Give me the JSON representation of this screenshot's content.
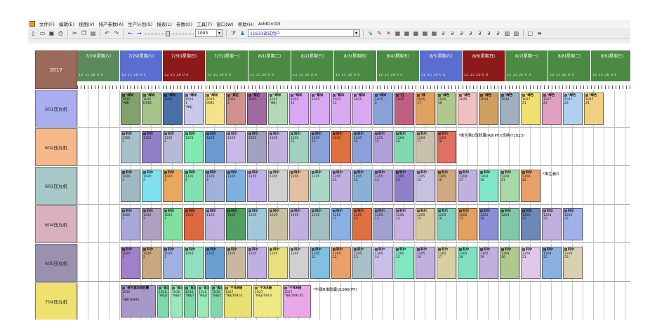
{
  "menu": [
    "文件(F)",
    "编辑(E)",
    "视图(V)",
    "排产参数(A)",
    "生产计划(S)",
    "报表(L)",
    "参数(O)",
    "工具(T)",
    "窗口(W)",
    "帮助(H)",
    "AddOn(D)"
  ],
  "toolbar": {
    "zoom_value": "1005",
    "line_combo_value": "11633调试用户"
  },
  "year_label": "2017",
  "hours_label": "12 15 20 0 4",
  "dates": [
    {
      "label": "7/29(星期六)",
      "color": "#5a8a5a"
    },
    {
      "label": "7/29(星期六)",
      "color": "#5a6ed0"
    },
    {
      "label": "7/30(星期日)",
      "color": "#8c1a1a"
    },
    {
      "label": "7/31(星期一)",
      "color": "#4a8a42"
    },
    {
      "label": "8/1(星期二)",
      "color": "#4a8a42"
    },
    {
      "label": "8/2(星期三)",
      "color": "#4a8a42"
    },
    {
      "label": "8/3(星期四)",
      "color": "#4a8a42"
    },
    {
      "label": "8/4(星期五)",
      "color": "#4a8a42"
    },
    {
      "label": "8/5(星期六)",
      "color": "#5a6ed0"
    },
    {
      "label": "8/6(星期日)",
      "color": "#8c1a1a"
    },
    {
      "label": "8/7(星期一)",
      "color": "#4a8a42"
    },
    {
      "label": "8/8(星期二)",
      "color": "#4a8a42"
    },
    {
      "label": "8/9(星期三)",
      "color": "#4a8a42"
    }
  ],
  "rows": [
    {
      "name": "601压丸机",
      "color": "#a8aef0",
      "tasks": [
        {
          "l1": "\"绿米",
          "l2": "1015",
          "l3": "",
          "l4": "\"NBJ",
          "color": "#7fa36a"
        },
        {
          "l1": "\"绿米",
          "l2": "1015",
          "l3": "",
          "l4": "D082",
          "color": "#a7c48a"
        },
        {
          "l1": "\"绿米",
          "l2": "1015",
          "l3": "",
          "l4": "",
          "color": "#4a6ea8"
        },
        {
          "l1": "\"绿米",
          "l2": "1015",
          "l3": "1",
          "l4": "\"NBJ",
          "color": "#c9c7ea"
        },
        {
          "l1": "\"绿米",
          "l2": "1020",
          "l3": "",
          "l4": "0081",
          "color": "#f3e28a"
        },
        {
          "l1": "\"紫红",
          "l2": "1023",
          "l3": "2",
          "l4": "",
          "color": "#d09090"
        },
        {
          "l1": "\"紫红",
          "l2": "1023",
          "l3": "",
          "l4": "",
          "color": "#a06aa0"
        },
        {
          "l1": "\"绿米",
          "l2": "1015",
          "l3": "",
          "l4": "\"NBJ",
          "color": "#b4d8b4"
        },
        {
          "l1": "\"绿米",
          "l2": "1015",
          "l3": "11",
          "l4": "",
          "color": "#d8a8f0"
        },
        {
          "l1": "\"紫米",
          "l2": "1015",
          "l3": "",
          "l4": "",
          "color": "#d8a8f0"
        },
        {
          "l1": "\"紫米",
          "l2": "1015",
          "l3": "12",
          "l4": "",
          "color": "#d8a8f0"
        },
        {
          "l1": "\"紫米",
          "l2": "1015",
          "l3": "",
          "l4": "",
          "color": "#d8a8f0"
        },
        {
          "l1": "\"绿米",
          "l2": "1015",
          "l3": "2",
          "l4": "",
          "color": "#8aa0d8"
        },
        {
          "l1": "\"红",
          "l2": "1025",
          "l3": "",
          "l4": "",
          "color": "#c06080"
        },
        {
          "l1": "\"绿",
          "l2": "1025",
          "l3": "17",
          "l4": "",
          "color": "#e0a060"
        },
        {
          "l1": "\"绿色",
          "l2": "1025",
          "l3": "18",
          "l4": "",
          "color": "#b0c890"
        },
        {
          "l1": "\"绿色",
          "l2": "1025",
          "l3": "",
          "l4": "",
          "color": "#f0c0c0"
        },
        {
          "l1": "\"绿色",
          "l2": "1014",
          "l3": "",
          "l4": "",
          "color": "#d0a060"
        },
        {
          "l1": "\"绿色",
          "l2": "1014",
          "l3": "",
          "l4": "",
          "color": "#a0b0c0"
        },
        {
          "l1": "\"绿色",
          "l2": "1027",
          "l3": "21",
          "l4": "",
          "color": "#f0e070"
        },
        {
          "l1": "\"绿色",
          "l2": "1027",
          "l3": "22",
          "l4": "",
          "color": "#e0a0c0"
        },
        {
          "l1": "\"绿色",
          "l2": "1027",
          "l3": "23",
          "l4": "",
          "color": "#b0d0f0"
        },
        {
          "l1": "\"绿色",
          "l2": "1027",
          "l3": "24",
          "l4": "",
          "color": "#f0d080"
        }
      ]
    },
    {
      "name": "602压丸机",
      "color": "#f5b888",
      "note": "*维生素D软胶囊(A8(PF)(规格IT1823)",
      "tasks": [
        {
          "l1": "科尔",
          "l2": "1105",
          "l3": "1",
          "l4": "",
          "color": "#a8c0c8"
        },
        {
          "l1": "科尔",
          "l2": "1105",
          "l3": "",
          "l4": "",
          "color": "#9080c8"
        },
        {
          "l1": "科尔",
          "l2": "1105",
          "l3": "3",
          "l4": "",
          "color": "#b8b8d8"
        },
        {
          "l1": "科尔",
          "l2": "1205",
          "l3": "",
          "l4": "",
          "color": "#80e8b0"
        },
        {
          "l1": "科尔",
          "l2": "1205",
          "l3": "",
          "l4": "",
          "color": "#6a9ad0"
        },
        {
          "l1": "科尔",
          "l2": "1205",
          "l3": "",
          "l4": "",
          "color": "#c8b8e8"
        },
        {
          "l1": "科尔",
          "l2": "1205",
          "l3": "",
          "l4": "",
          "color": "#a0a0c0"
        },
        {
          "l1": "科尔",
          "l2": "1205",
          "l3": "",
          "l4": "",
          "color": "#c0b0e0"
        },
        {
          "l1": "科尔",
          "l2": "1205",
          "l3": "11",
          "l4": "",
          "color": "#a0d0c0"
        },
        {
          "l1": "科尔",
          "l2": "1205",
          "l3": "12",
          "l4": "",
          "color": "#8aa0d8"
        },
        {
          "l1": "科尔",
          "l2": "1205",
          "l3": "",
          "l4": "",
          "color": "#e07040"
        },
        {
          "l1": "科尔",
          "l2": "1205",
          "l3": "14",
          "l4": "",
          "color": "#8aa0d8"
        },
        {
          "l1": "科尔",
          "l2": "1205",
          "l3": "15",
          "l4": "",
          "color": "#b0a0d8"
        },
        {
          "l1": "科尔",
          "l2": "1204",
          "l3": "16",
          "l4": "",
          "color": "#80d8b0"
        },
        {
          "l1": "科尔",
          "l2": "1204",
          "l3": "17",
          "l4": "",
          "color": "#c8c0a8"
        },
        {
          "l1": "科尔",
          "l2": "1204",
          "l3": "18",
          "l4": "",
          "color": "#e07060"
        }
      ]
    },
    {
      "name": "603压丸机",
      "color": "#a8c8c8",
      "note": "*维生素D",
      "tasks": [
        {
          "l1": "科尔",
          "l2": "1020",
          "l3": "1",
          "l4": "",
          "color": "#a0b8c0"
        },
        {
          "l1": "科尔",
          "l2": "1020",
          "l3": "2",
          "l4": "",
          "color": "#80e0f0"
        },
        {
          "l1": "科尔",
          "l2": "1020",
          "l3": "3",
          "l4": "",
          "color": "#e8a860"
        },
        {
          "l1": "科尔",
          "l2": "1105",
          "l3": "4",
          "l4": "",
          "color": "#80e0b0"
        },
        {
          "l1": "科尔",
          "l2": "1105",
          "l3": "5",
          "l4": "",
          "color": "#a0b0d8"
        },
        {
          "l1": "科尔",
          "l2": "1105",
          "l3": "",
          "l4": "",
          "color": "#80b0e0"
        },
        {
          "l1": "科尔",
          "l2": "1205",
          "l3": "",
          "l4": "",
          "color": "#c0b0e8"
        },
        {
          "l1": "科尔",
          "l2": "1205",
          "l3": "",
          "l4": "",
          "color": "#d0d0d0"
        },
        {
          "l1": "科尔",
          "l2": "1205",
          "l3": "",
          "l4": "",
          "color": "#e0c0a0"
        },
        {
          "l1": "科尔",
          "l2": "1205",
          "l3": "",
          "l4": "",
          "color": "#a8d8c8"
        },
        {
          "l1": "科尔",
          "l2": "1205",
          "l3": "11",
          "l4": "",
          "color": "#c0b0e0"
        },
        {
          "l1": "科尔",
          "l2": "1205",
          "l3": "12",
          "l4": "",
          "color": "#8ab0d8"
        },
        {
          "l1": "科尔",
          "l2": "1205",
          "l3": "13",
          "l4": "",
          "color": "#b0a0d8"
        },
        {
          "l1": "科尔",
          "l2": "1205",
          "l3": "14",
          "l4": "",
          "color": "#9080c8"
        },
        {
          "l1": "科尔",
          "l2": "1205",
          "l3": "15",
          "l4": "",
          "color": "#c8c0e0"
        },
        {
          "l1": "科尔",
          "l2": "1205",
          "l3": "16",
          "l4": "",
          "color": "#d0a880"
        },
        {
          "l1": "科尔",
          "l2": "1204",
          "l3": "17",
          "l4": "",
          "color": "#c0b0e0"
        },
        {
          "l1": "科尔",
          "l2": "1204",
          "l3": "18",
          "l4": "",
          "color": "#80e8c8"
        },
        {
          "l1": "科尔",
          "l2": "1204",
          "l3": "21",
          "l4": "",
          "color": "#a8d8a8"
        },
        {
          "l1": "科尔",
          "l2": "1204",
          "l3": "22",
          "l4": "",
          "color": "#e8a068"
        }
      ]
    },
    {
      "name": "604压丸机",
      "color": "#d8b0c0",
      "tasks": [
        {
          "l1": "科尔",
          "l2": "1020",
          "l3": "1",
          "l4": "",
          "color": "#a8a8d8"
        },
        {
          "l1": "科尔",
          "l2": "1020",
          "l3": "2",
          "l4": "",
          "color": "#b0a0c0"
        },
        {
          "l1": "科尔",
          "l2": "1020",
          "l3": "3",
          "l4": "",
          "color": "#80e0a0"
        },
        {
          "l1": "科尔",
          "l2": "1105",
          "l3": "",
          "l4": "",
          "color": "#e06840"
        },
        {
          "l1": "科尔",
          "l2": "1105",
          "l3": "",
          "l4": "",
          "color": "#c0b0e0"
        },
        {
          "l1": "科尔",
          "l2": "1105",
          "l3": "",
          "l4": "",
          "color": "#50a060"
        },
        {
          "l1": "科尔",
          "l2": "1105",
          "l3": "",
          "l4": "",
          "color": "#a0c8d8"
        },
        {
          "l1": "科尔",
          "l2": "1205",
          "l3": "",
          "l4": "",
          "color": "#c8c0a0"
        },
        {
          "l1": "科尔",
          "l2": "1205",
          "l3": "",
          "l4": "",
          "color": "#c0b0e0"
        },
        {
          "l1": "科尔",
          "l2": "1205",
          "l3": "",
          "l4": "",
          "color": "#a0c0c0"
        },
        {
          "l1": "科尔",
          "l2": "1205",
          "l3": "11",
          "l4": "",
          "color": "#8ab0e8"
        },
        {
          "l1": "科尔",
          "l2": "1205",
          "l3": "12",
          "l4": "",
          "color": "#e07040"
        },
        {
          "l1": "科尔",
          "l2": "1205",
          "l3": "13",
          "l4": "",
          "color": "#a0a0d0"
        },
        {
          "l1": "科尔",
          "l2": "1205",
          "l3": "14",
          "l4": "",
          "color": "#c8b0e0"
        },
        {
          "l1": "科尔",
          "l2": "1205",
          "l3": "15",
          "l4": "",
          "color": "#d8c8a0"
        },
        {
          "l1": "科尔",
          "l2": "1205",
          "l3": "16",
          "l4": "",
          "color": "#80d0c0"
        },
        {
          "l1": "科尔",
          "l2": "1205",
          "l3": "17",
          "l4": "",
          "color": "#e0a060"
        },
        {
          "l1": "科尔",
          "l2": "1205",
          "l3": "18",
          "l4": "",
          "color": "#8a90d8"
        },
        {
          "l1": "科尔",
          "l2": "1204",
          "l3": "",
          "l4": "",
          "color": "#80c8a8"
        },
        {
          "l1": "科尔",
          "l2": "1204",
          "l3": "21",
          "l4": "",
          "color": "#6a88b8"
        },
        {
          "l1": "科尔",
          "l2": "1204",
          "l3": "22",
          "l4": "",
          "color": "#c0b0e0"
        },
        {
          "l1": "科尔",
          "l2": "1204",
          "l3": "23",
          "l4": "",
          "color": "#a0b0e8"
        }
      ]
    },
    {
      "name": "605压丸机",
      "color": "#9a90b0",
      "tasks": [
        {
          "l1": "科尔",
          "l2": "1020",
          "l3": "1",
          "l4": "",
          "color": "#a080c8"
        },
        {
          "l1": "科尔",
          "l2": "1020",
          "l3": "2",
          "l4": "",
          "color": "#c8a880"
        },
        {
          "l1": "科尔",
          "l2": "1020",
          "l3": "3",
          "l4": "",
          "color": "#a0b0e0"
        },
        {
          "l1": "科尔",
          "l2": "1020",
          "l3": "",
          "l4": "",
          "color": "#90e0c0"
        },
        {
          "l1": "科尔",
          "l2": "1105",
          "l3": "",
          "l4": "",
          "color": "#6aa0d0"
        },
        {
          "l1": "科尔",
          "l2": "1105",
          "l3": "",
          "l4": "",
          "color": "#c8b8a0"
        },
        {
          "l1": "科尔",
          "l2": "1205",
          "l3": "",
          "l4": "",
          "color": "#c0b0e0"
        },
        {
          "l1": "科尔",
          "l2": "1205",
          "l3": "",
          "l4": "",
          "color": "#e8e080"
        },
        {
          "l1": "科尔",
          "l2": "1205",
          "l3": "",
          "l4": "",
          "color": "#d0d0d0"
        },
        {
          "l1": "科尔",
          "l2": "1205",
          "l3": "11",
          "l4": "",
          "color": "#80c0e0"
        },
        {
          "l1": "科尔",
          "l2": "1205",
          "l3": "12",
          "l4": "",
          "color": "#e8a068"
        },
        {
          "l1": "科尔",
          "l2": "1205",
          "l3": "13",
          "l4": "",
          "color": "#a8c0c8"
        },
        {
          "l1": "科尔",
          "l2": "1205",
          "l3": "14",
          "l4": "",
          "color": "#c8c0e8"
        },
        {
          "l1": "科尔",
          "l2": "1205",
          "l3": "15",
          "l4": "",
          "color": "#80e8c0"
        },
        {
          "l1": "科尔",
          "l2": "1205",
          "l3": "16",
          "l4": "",
          "color": "#c0b0e0"
        },
        {
          "l1": "科尔",
          "l2": "1205",
          "l3": "17",
          "l4": "",
          "color": "#d8d0a0"
        },
        {
          "l1": "科尔",
          "l2": "1205",
          "l3": "18",
          "l4": "",
          "color": "#80e0c0"
        },
        {
          "l1": "科尔",
          "l2": "1102",
          "l3": "19",
          "l4": "",
          "color": "#c0b0e0"
        },
        {
          "l1": "科尔",
          "l2": "1204",
          "l3": "20",
          "l4": "",
          "color": "#b0c890"
        },
        {
          "l1": "科尔",
          "l2": "1204",
          "l3": "21",
          "l4": "",
          "color": "#e0c8e8"
        },
        {
          "l1": "科尔",
          "l2": "1204",
          "l3": "22",
          "l4": "",
          "color": "#8ab0e0"
        },
        {
          "l1": "科尔",
          "l2": "1204",
          "l3": "23",
          "l4": "",
          "color": "#d8d0b0"
        }
      ]
    },
    {
      "name": "704压丸机",
      "color": "#f0e070",
      "note": "*牛磺R维胶囊(J1996(PF)",
      "tasks": [
        {
          "l1": "\"维生素D软胶囊",
          "l2": "1010",
          "l3": "1",
          "l4": "\"NBJT0994",
          "color": "#a898c8",
          "w": 50
        },
        {
          "l1": "\"鱼油",
          "l2": "1010",
          "l3": "",
          "l4": "\"NBJT",
          "color": "#80d8a8",
          "w": 17
        },
        {
          "l1": "\"鱼油",
          "l2": "1010",
          "l3": "",
          "l4": "\"NBJT",
          "color": "#98e8b8",
          "w": 17
        },
        {
          "l1": "\"鱼油",
          "l2": "1010",
          "l3": "",
          "l4": "\"NBJT",
          "color": "#80d8a8",
          "w": 17
        },
        {
          "l1": "\"鱼油",
          "l2": "1010",
          "l3": "",
          "l4": "\"NBJT",
          "color": "#98e8b8",
          "w": 17
        },
        {
          "l1": "\"鱼油",
          "l2": "1010",
          "l3": "",
          "l4": "\"NBJT",
          "color": "#80d8a8",
          "w": 17
        },
        {
          "l1": "\"千禾R维",
          "l2": "1027",
          "l3": "",
          "l4": "\"NBJT0914",
          "color": "#e8e070",
          "w": 40
        },
        {
          "l1": "\"千禾R维",
          "l2": "1027",
          "l3": "",
          "l4": "\"NBJT0914",
          "color": "#f0e880",
          "w": 40
        },
        {
          "l1": "\"千禾R维",
          "l2": "1027",
          "l3": "",
          "l4": "\"NBJT09145",
          "color": "#e8a8e8",
          "w": 40
        }
      ]
    }
  ]
}
